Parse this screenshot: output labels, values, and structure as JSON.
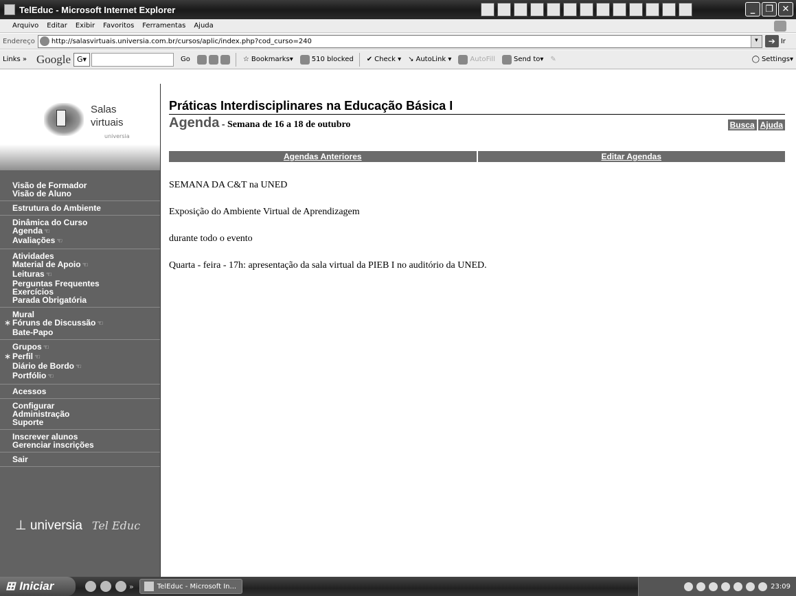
{
  "window": {
    "title": "TelEduc - Microsoft Internet Explorer",
    "controls": [
      "_",
      "❐",
      "✕"
    ]
  },
  "menubar": [
    "Arquivo",
    "Editar",
    "Exibir",
    "Favoritos",
    "Ferramentas",
    "Ajuda"
  ],
  "address": {
    "label": "Endereço",
    "url": "http://salasvirtuais.universia.com.br/cursos/aplic/index.php?cod_curso=240",
    "go": "Ir"
  },
  "linksbar": {
    "links": "Links »",
    "google": "Google",
    "g_box": "G▾",
    "go": "Go",
    "bookmarks": "Bookmarks▾",
    "blocked": "510 blocked",
    "check": "Check ▾",
    "autolink": "AutoLink ▾",
    "autofill": "AutoFill",
    "sendto": "Send to▾",
    "settings": "Settings▾"
  },
  "sidebar": {
    "logo": {
      "line1": "Salas",
      "line2": "virtuais",
      "line3": "universia"
    },
    "groups": [
      {
        "items": [
          {
            "label": "Visão de Formador"
          },
          {
            "label": "Visão de Aluno"
          }
        ]
      },
      {
        "items": [
          {
            "label": "Estrutura do Ambiente"
          }
        ]
      },
      {
        "items": [
          {
            "label": "Dinâmica do Curso"
          },
          {
            "label": "Agenda",
            "hand": true
          },
          {
            "label": "Avaliações",
            "hand": true
          }
        ]
      },
      {
        "items": [
          {
            "label": "Atividades"
          },
          {
            "label": "Material de Apoio",
            "hand": true
          },
          {
            "label": "Leituras",
            "hand": true
          },
          {
            "label": "Perguntas Frequentes"
          },
          {
            "label": "Exercícios"
          },
          {
            "label": "Parada Obrigatória"
          }
        ]
      },
      {
        "items": [
          {
            "label": "Mural"
          },
          {
            "label": "Fóruns de Discussão",
            "hand": true,
            "star": true
          },
          {
            "label": "Bate-Papo"
          }
        ]
      },
      {
        "items": [
          {
            "label": "Grupos",
            "hand": true
          },
          {
            "label": "Perfil",
            "hand": true,
            "star": true
          },
          {
            "label": "Diário de Bordo",
            "hand": true
          },
          {
            "label": "Portfólio",
            "hand": true
          }
        ]
      },
      {
        "items": [
          {
            "label": "Acessos"
          }
        ]
      },
      {
        "items": [
          {
            "label": "Configurar"
          },
          {
            "label": "Administração"
          },
          {
            "label": "Suporte"
          }
        ]
      },
      {
        "items": [
          {
            "label": "Inscrever alunos"
          },
          {
            "label": "Gerenciar inscrições"
          }
        ]
      },
      {
        "items": [
          {
            "label": "Sair"
          }
        ]
      }
    ],
    "footer": {
      "universia": "universia",
      "teleduc": "Tel Educ"
    }
  },
  "content": {
    "course_title": "Práticas Interdisciplinares na Educação Básica I",
    "section": "Agenda",
    "subtitle": " - Semana de 16 a 18 de outubro",
    "links": {
      "busca": "Busca",
      "ajuda": "Ajuda"
    },
    "tabs": {
      "anteriores": "Agendas Anteriores",
      "editar": "Editar Agendas"
    },
    "paragraphs": [
      "SEMANA DA C&T na UNED",
      "Exposição do Ambiente Virtual de Aprendizagem",
      "durante todo o evento",
      "Quarta - feira - 17h: apresentação da sala virtual da PIEB I no auditório da UNED."
    ]
  },
  "taskbar": {
    "start": "Iniciar",
    "task": "TelEduc - Microsoft In...",
    "clock": "23:09"
  }
}
